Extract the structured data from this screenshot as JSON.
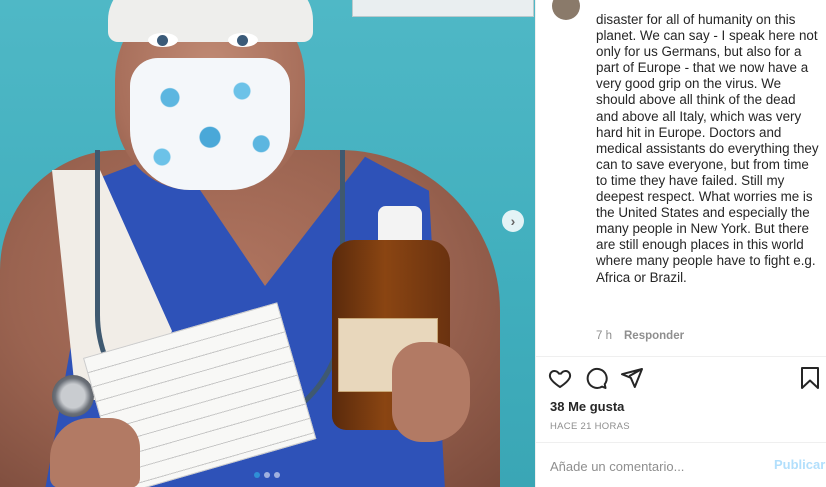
{
  "post": {
    "caption_text": "disaster for all of humanity on this planet. We can say - I speak here not only for us Germans, but also for a part of Europe - that we now have a very good grip on the virus. We should above all think of the dead and above all Italy, which was very hard hit in Europe. Doctors and medical assistants do everything they can to save everyone, but from time to time they have failed. Still my deepest respect. What worries me is the United States and especially the many people in New York. But there are still enough places in this world where many people have to fight e.g. Africa or Brazil.",
    "comment_age": "7 h",
    "reply_label": "Responder"
  },
  "actions": {
    "like_icon": "heart-icon",
    "comment_icon": "comment-bubble-icon",
    "share_icon": "paper-plane-icon",
    "save_icon": "bookmark-icon"
  },
  "stats": {
    "likes_label": "38 Me gusta",
    "timestamp": "HACE 21 HORAS"
  },
  "composer": {
    "placeholder": "Añade un comentario...",
    "publish_label": "Publicar"
  },
  "carousel": {
    "next_icon": "chevron-right-icon",
    "slide_count": 3,
    "active_slide": 1
  },
  "colors": {
    "publish_disabled": "#b2dffc",
    "active_dot": "#2f8fd6",
    "meta_text": "#8e8e8e"
  }
}
